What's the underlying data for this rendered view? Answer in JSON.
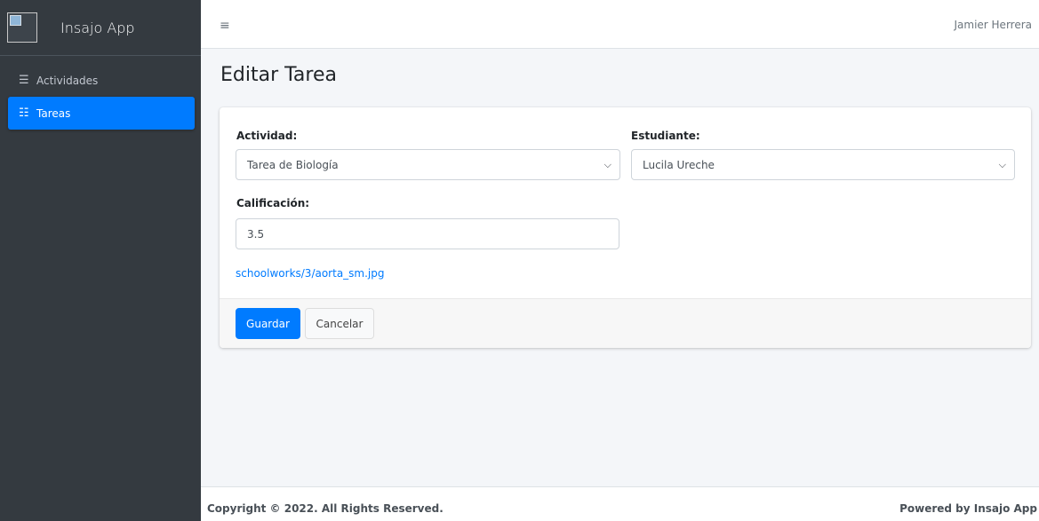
{
  "brand": {
    "name": "Insajo App",
    "logo_icon": "broken-image-icon"
  },
  "sidebar": {
    "items": [
      {
        "label": "Actividades",
        "icon": "list-icon",
        "active": false
      },
      {
        "label": "Tareas",
        "icon": "checklist-icon",
        "active": true
      }
    ]
  },
  "topbar": {
    "menu_icon": "hamburger-icon",
    "user": "Jamier Herrera"
  },
  "page": {
    "title": "Editar Tarea"
  },
  "form": {
    "actividad": {
      "label": "Actividad:",
      "value": "Tarea de Biología"
    },
    "estudiante": {
      "label": "Estudiante:",
      "value": "Lucila Ureche"
    },
    "calificacion": {
      "label": "Calificación:",
      "value": "3.5"
    },
    "file_link": "schoolworks/3/aorta_sm.jpg",
    "save_label": "Guardar",
    "cancel_label": "Cancelar"
  },
  "footer": {
    "copyright": "Copyright © 2022. All Rights Reserved.",
    "powered": "Powered by Insajo App"
  },
  "colors": {
    "primary": "#007bff",
    "sidebar_bg": "#343a40",
    "content_bg": "#f4f6f9"
  }
}
